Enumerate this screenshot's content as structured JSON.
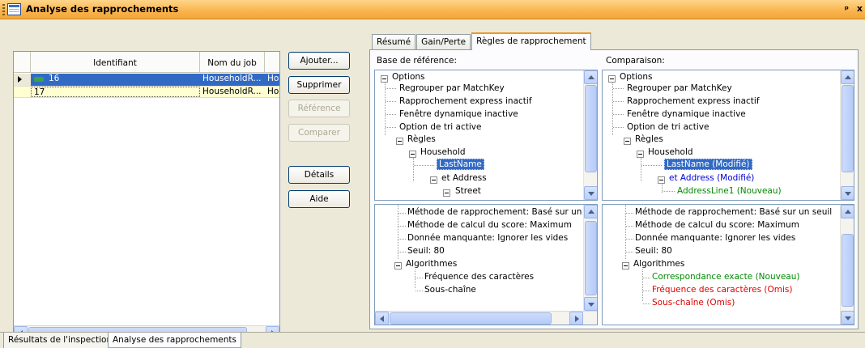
{
  "window": {
    "title": "Analyse des rapprochements"
  },
  "grid": {
    "columns": [
      "Identifiant",
      "Nom du job"
    ],
    "rows": [
      {
        "id": "16",
        "job": "HouseholdR...",
        "extra": "Hous"
      },
      {
        "id": "17",
        "job": "HouseholdR...",
        "extra": "Hous"
      }
    ]
  },
  "buttons": {
    "add": "Ajouter...",
    "delete": "Supprimer",
    "reference": "Référence",
    "compare": "Comparer",
    "details": "Détails",
    "help": "Aide"
  },
  "tabs": [
    "Résumé",
    "Gain/Perte",
    "Règles de rapprochement"
  ],
  "base_label": "Base de référence:",
  "comparison_label": "Comparaison:",
  "tree_common": {
    "options": "Options",
    "group": "Regrouper par MatchKey",
    "express": "Rapprochement express inactif",
    "window": "Fenêtre dynamique inactive",
    "sort": "Option de tri active",
    "rules": "Règles",
    "household": "Household"
  },
  "base_tree": {
    "lastname": "LastName",
    "address": "et Address",
    "street": "Street"
  },
  "comp_tree": {
    "lastname": "LastName (Modifié)",
    "address": "et Address (Modifié)",
    "addressline": "AddressLine1 (Nouveau)"
  },
  "base_detail": {
    "method": "Méthode de rapprochement: Basé sur un se",
    "score": "Méthode de calcul du score: Maximum",
    "missing": "Donnée manquante: Ignorer les vides",
    "threshold": "Seuil: 80",
    "algos": "Algorithmes",
    "freq": "Fréquence des caractères",
    "substr": "Sous-chaîne"
  },
  "comp_detail": {
    "method": "Méthode de rapprochement: Basé sur un seuil",
    "score": "Méthode de calcul du score: Maximum",
    "missing": "Donnée manquante: Ignorer les vides",
    "threshold": "Seuil: 80",
    "algos": "Algorithmes",
    "exact": "Correspondance exacte (Nouveau)",
    "freq": "Fréquence des caractères (Omis)",
    "substr": "Sous-chaîne (Omis)"
  },
  "bottom_tabs": [
    "Résultats de l'inspection",
    "Analyse des rapprochements"
  ],
  "colors": {
    "added": "#008a00",
    "modified": "#0000d8",
    "omitted": "#e00000",
    "active_tab": "#e89b2c"
  }
}
